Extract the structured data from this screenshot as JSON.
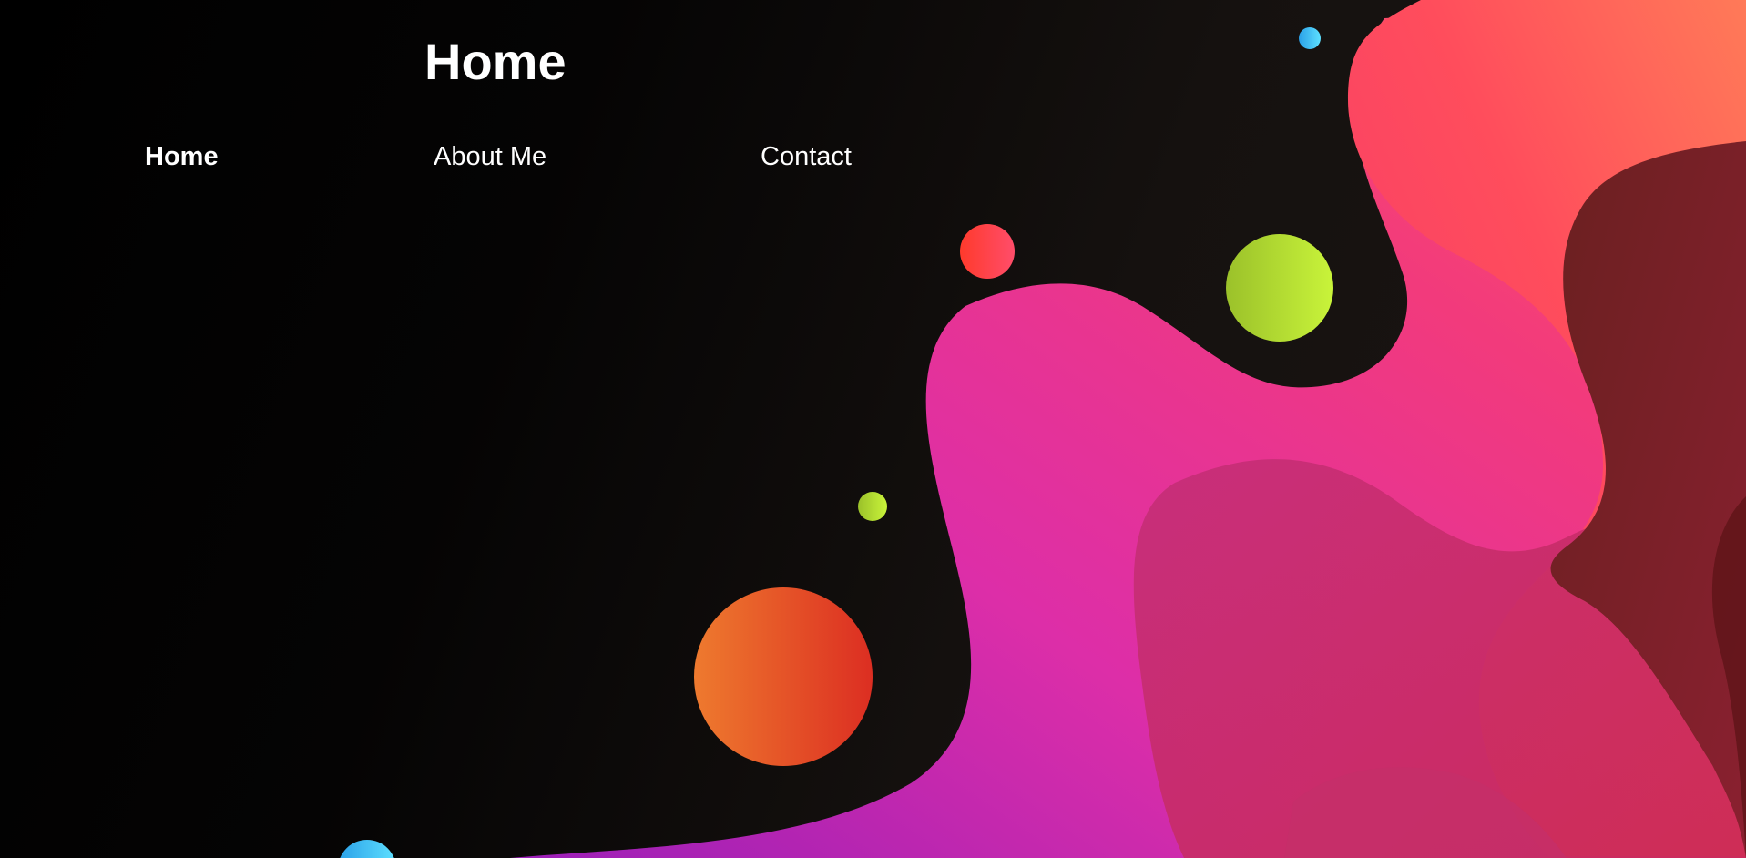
{
  "page": {
    "title": "Home"
  },
  "nav": {
    "items": [
      {
        "label": "Home",
        "active": true
      },
      {
        "label": "About Me",
        "active": false
      },
      {
        "label": "Contact",
        "active": false
      }
    ]
  },
  "colors": {
    "background": "#000000",
    "text": "#ffffff",
    "blob_pink": "#e23aa8",
    "blob_coral": "#ff4d60",
    "blob_dark_red": "#7a1d24",
    "orb_lime": "#b7e43a",
    "orb_orange": "#ea6a2c",
    "orb_red": "#ff3b3b",
    "orb_cyan": "#3dc4f0"
  },
  "decorations": {
    "shapes": [
      "pink-blob",
      "coral-blob",
      "dark-red-blob",
      "lime-orb",
      "orange-orb",
      "red-orb",
      "cyan-orb"
    ]
  }
}
